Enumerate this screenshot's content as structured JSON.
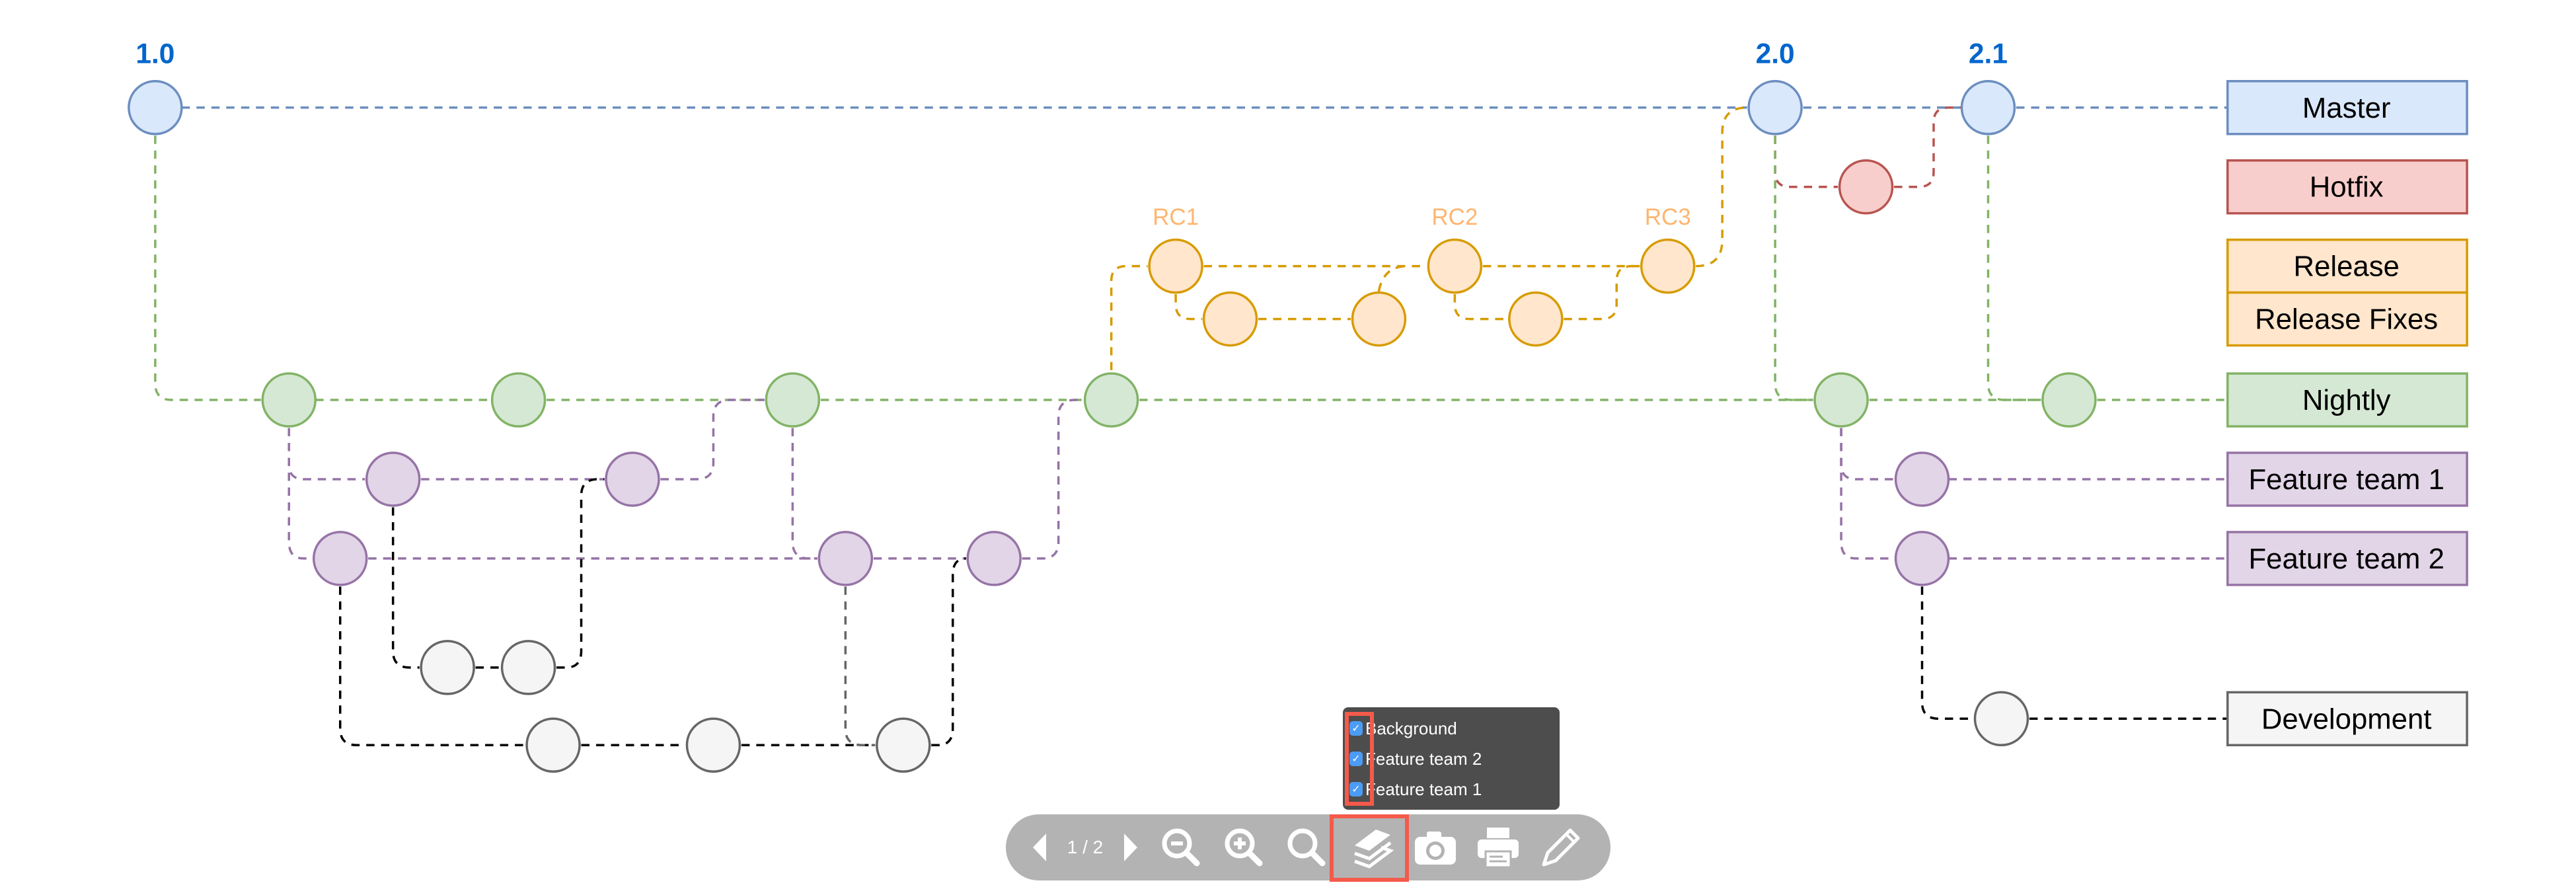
{
  "colors": {
    "master": {
      "fill": "#DAE8FC",
      "stroke": "#6C8EBF"
    },
    "hotfix": {
      "fill": "#F8CECC",
      "stroke": "#B85450"
    },
    "release": {
      "fill": "#FFE6CC",
      "stroke": "#D79B00"
    },
    "nightly": {
      "fill": "#D5E8D4",
      "stroke": "#82B366"
    },
    "feature": {
      "fill": "#E1D5E7",
      "stroke": "#9673A6"
    },
    "development": {
      "fill": "#F5F5F5",
      "stroke": "#666666"
    },
    "version_text": "#0066CC",
    "rc_text": "#FFB570",
    "highlight": "#F55A4A"
  },
  "versions": [
    {
      "label": "1.0"
    },
    {
      "label": "2.0"
    },
    {
      "label": "2.1"
    }
  ],
  "release_candidates": [
    {
      "label": "RC1"
    },
    {
      "label": "RC2"
    },
    {
      "label": "RC3"
    }
  ],
  "legend": [
    {
      "id": "master",
      "label": "Master"
    },
    {
      "id": "hotfix",
      "label": "Hotfix"
    },
    {
      "id": "release",
      "label": "Release"
    },
    {
      "id": "release_fixes",
      "label": "Release Fixes"
    },
    {
      "id": "nightly",
      "label": "Nightly"
    },
    {
      "id": "feature1",
      "label": "Feature team 1"
    },
    {
      "id": "feature2",
      "label": "Feature team 2"
    },
    {
      "id": "development",
      "label": "Development"
    }
  ],
  "layers_popup": {
    "items": [
      {
        "label": "Background",
        "checked": true
      },
      {
        "label": "Feature team 2",
        "checked": true
      },
      {
        "label": "Feature team 1",
        "checked": true
      }
    ]
  },
  "toolbar": {
    "page_indicator": "1 / 2",
    "buttons": [
      "previous-page",
      "next-page",
      "zoom-out",
      "zoom-in",
      "zoom-fit",
      "layers",
      "screenshot",
      "print",
      "edit"
    ]
  }
}
